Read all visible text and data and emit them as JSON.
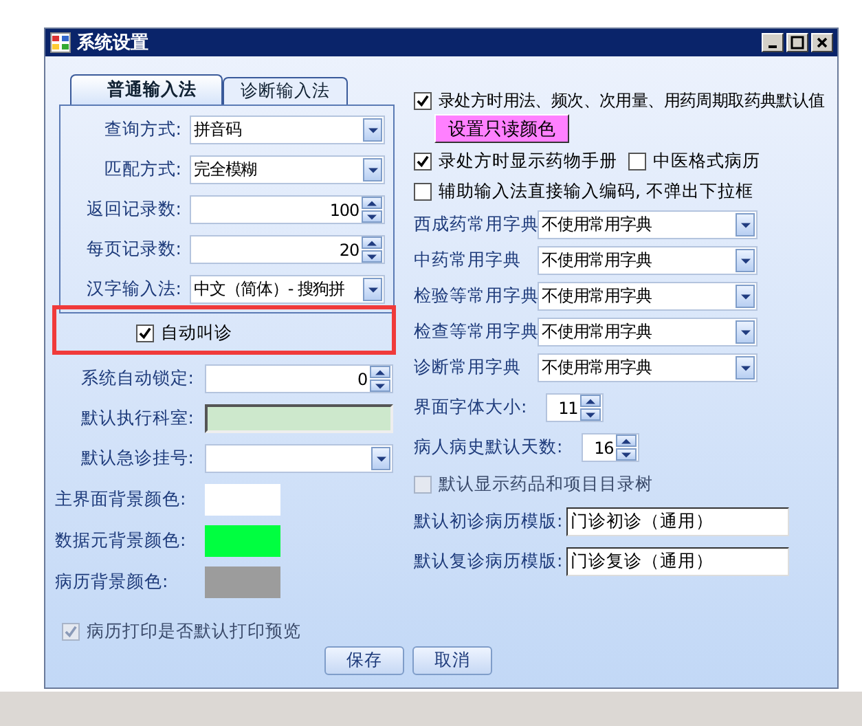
{
  "window": {
    "title": "系统设置"
  },
  "tabs": [
    {
      "label": "普通输入法",
      "selected": true
    },
    {
      "label": "诊断输入法",
      "selected": false
    }
  ],
  "tab_fields": [
    {
      "label": "查询方式:",
      "kind": "combo",
      "value": "拼音码"
    },
    {
      "label": "匹配方式:",
      "kind": "combo",
      "value": "完全模糊"
    },
    {
      "label": "返回记录数:",
      "kind": "spin",
      "value": "100"
    },
    {
      "label": "每页记录数:",
      "kind": "spin",
      "value": "20"
    },
    {
      "label": "汉字输入法:",
      "kind": "combo",
      "value": "中文（简体）- 搜狗拼"
    }
  ],
  "auto_call": {
    "label": "自动叫诊",
    "checked": true,
    "highlighted": true
  },
  "left_fields": [
    {
      "label": "系统自动锁定:",
      "kind": "spin",
      "value": "0"
    },
    {
      "label": "默认执行科室:",
      "kind": "field"
    },
    {
      "label": "默认急诊挂号:",
      "kind": "combo"
    },
    {
      "label": "主界面背景颜色:",
      "kind": "color",
      "color": "#ffffff"
    },
    {
      "label": "数据元背景颜色:",
      "kind": "color",
      "color": "#00ff40"
    },
    {
      "label": "病历背景颜色:",
      "kind": "color",
      "color": "#9c9c9c"
    }
  ],
  "print_preview": {
    "label": "病历打印是否默认打印预览",
    "checked": true,
    "disabled": true
  },
  "prescription_default": {
    "label": "录处方时用法、频次、次用量、用药周期取药典默认值",
    "checked": true
  },
  "readonly_color_button": {
    "label": "设置只读颜色"
  },
  "check_row": [
    {
      "label": "录处方时显示药物手册",
      "checked": true
    },
    {
      "label": "中医格式病历",
      "checked": false
    }
  ],
  "aux_input": {
    "label": "辅助输入法直接输入编码, 不弹出下拉框",
    "checked": false
  },
  "dictionaries": [
    {
      "label": "西成药常用字典",
      "value": "不使用常用字典"
    },
    {
      "label": "中药常用字典",
      "value": "不使用常用字典"
    },
    {
      "label": "检验等常用字典",
      "value": "不使用常用字典"
    },
    {
      "label": "检查等常用字典",
      "value": "不使用常用字典"
    },
    {
      "label": "诊断常用字典",
      "value": "不使用常用字典"
    }
  ],
  "right_spins": [
    {
      "label": "界面字体大小:",
      "value": "11"
    },
    {
      "label": "病人病史默认天数:",
      "value": "16"
    }
  ],
  "show_tree": {
    "label": "默认显示药品和项目目录树",
    "checked": false,
    "disabled": true
  },
  "templates": [
    {
      "label": "默认初诊病历模版:",
      "value": "门诊初诊（通用）"
    },
    {
      "label": "默认复诊病历模版:",
      "value": "门诊复诊（通用）"
    }
  ],
  "buttons": [
    {
      "label": "保存"
    },
    {
      "label": "取消"
    }
  ]
}
